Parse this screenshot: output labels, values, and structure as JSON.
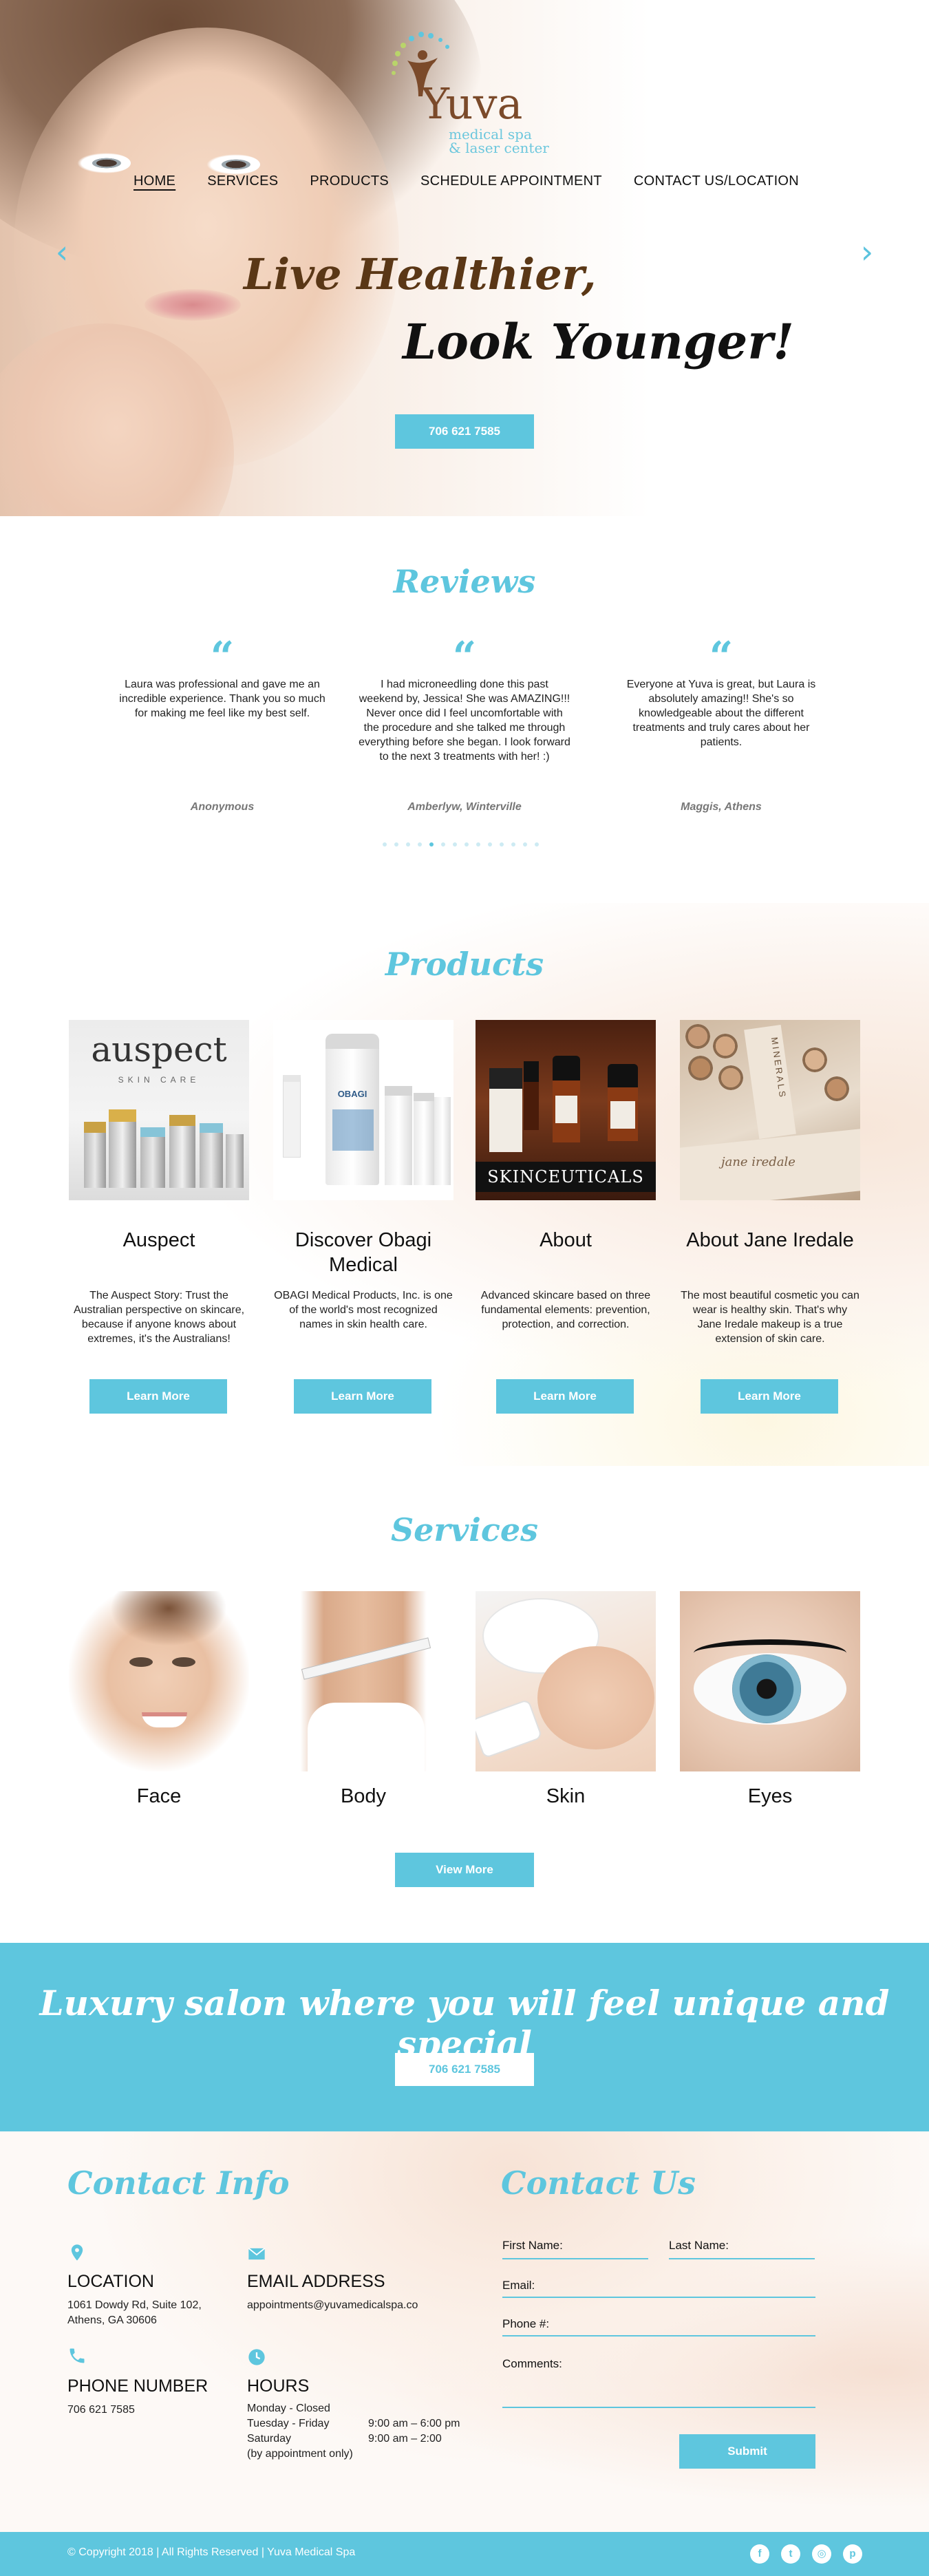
{
  "brand": {
    "name": "Yuva",
    "tagline_line1": "medical spa",
    "tagline_line2": "& laser center"
  },
  "nav": {
    "items": [
      "HOME",
      "SERVICES",
      "PRODUCTS",
      "SCHEDULE APPOINTMENT",
      "CONTACT US/LOCATION"
    ],
    "active": "HOME"
  },
  "hero": {
    "line1": "Live Healthier,",
    "line2": "Look Younger!",
    "phone_button": "706 621 7585"
  },
  "reviews": {
    "title": "Reviews",
    "items": [
      {
        "text": "Laura was professional and gave me an incredible experience. Thank you so much for making me feel like my best self.",
        "author": "Anonymous"
      },
      {
        "text": "I had microneedling done this past weekend by, Jessica! She was AMAZING!!! Never once did I feel uncomfortable with the procedure and she talked me through everything before she began. I look forward to the next 3 treatments with her! :)",
        "author": "Amberlyw, Winterville"
      },
      {
        "text": "Everyone at Yuva is great, but Laura is absolutely amazing!! She's so knowledgeable about the different treatments and truly cares about her patients.",
        "author": "Maggis, Athens"
      }
    ],
    "dot_count": 14,
    "active_dot": 4
  },
  "products": {
    "title": "Products",
    "items": [
      {
        "name": "Auspect",
        "desc": "The Auspect Story: Trust the Australian perspective on skincare, because if anyone knows about extremes, it's the Australians!",
        "button": "Learn More",
        "image_text": "auspect",
        "image_subtext": "SKIN CARE"
      },
      {
        "name": "Discover Obagi Medical",
        "desc": "OBAGI Medical Products, Inc. is one of the world's most recognized names in skin health care.",
        "button": "Learn More",
        "image_text": "OBAGI",
        "image_subtext": ""
      },
      {
        "name": "About",
        "desc": "Advanced skincare based on three fundamental elements: prevention, protection, and correction.",
        "button": "Learn More",
        "image_text": "SKINCEUTICALS",
        "image_subtext": ""
      },
      {
        "name": "About Jane Iredale",
        "desc": "The most beautiful cosmetic you can wear is healthy skin. That's why Jane Iredale makeup is a true extension of skin care.",
        "button": "Learn More",
        "image_text": "jane iredale",
        "image_subtext": "MINERALS"
      }
    ]
  },
  "services": {
    "title": "Services",
    "items": [
      {
        "label": "Face"
      },
      {
        "label": "Body"
      },
      {
        "label": "Skin"
      },
      {
        "label": "Eyes"
      }
    ],
    "button": "View More"
  },
  "banner": {
    "text": "Luxury salon where you will feel unique and special",
    "phone_button": "706 621 7585"
  },
  "contact_info": {
    "title": "Contact Info",
    "location": {
      "heading": "LOCATION",
      "line1": "1061 Dowdy Rd, Suite 102,",
      "line2": "Athens, GA 30606"
    },
    "email": {
      "heading": "EMAIL ADDRESS",
      "value": "appointments@yuvamedicalspa.co"
    },
    "phone": {
      "heading": "PHONE NUMBER",
      "value": "706 621 7585"
    },
    "hours": {
      "heading": "HOURS",
      "monday": "Monday - Closed",
      "tf_day": "Tuesday - Friday",
      "tf_time": "9:00 am – 6:00 pm",
      "sat_day": "Saturday",
      "sat_time": "9:00 am – 2:00",
      "note": "(by appointment only)"
    }
  },
  "contact_form": {
    "title": "Contact Us",
    "first_name": "First Name:",
    "last_name": "Last Name:",
    "email": "Email:",
    "phone": "Phone #:",
    "comments": "Comments:",
    "submit": "Submit"
  },
  "footer": {
    "copyright": "© Copyright 2018 | All Rights Reserved | Yuva Medical Spa",
    "social": [
      "facebook-icon",
      "twitter-icon",
      "instagram-icon",
      "pinterest-icon"
    ]
  },
  "colors": {
    "accent": "#5ec6de",
    "brand_brown": "#7b4a2a",
    "hero_script_brown": "#5a3716"
  }
}
